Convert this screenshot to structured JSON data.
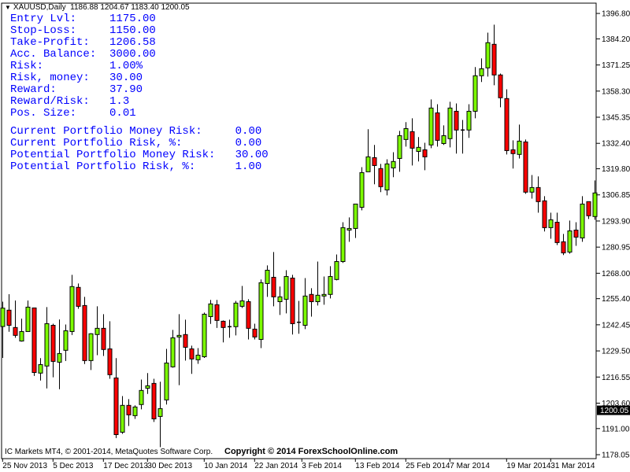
{
  "header": {
    "symbol": "XAUUSD,Daily",
    "ohlc": "1186.88 1204.67 1183.40 1200.05"
  },
  "panel": {
    "rows": [
      {
        "label": "Entry Lvl:",
        "value": "1175.00"
      },
      {
        "label": "Stop-Loss:",
        "value": "1150.00"
      },
      {
        "label": "Take-Profit:",
        "value": "1206.58"
      },
      {
        "label": "Acc. Balance:",
        "value": "3000.00"
      },
      {
        "label": "Risk:",
        "value": "1.00%"
      },
      {
        "label": "Risk, money:",
        "value": "30.00"
      },
      {
        "label": "Reward:",
        "value": "37.90"
      },
      {
        "label": "Reward/Risk:",
        "value": "1.3"
      },
      {
        "label": "Pos. Size:",
        "value": "0.01"
      }
    ],
    "portfolio": [
      {
        "label": "Current Portfolio Money Risk:",
        "value": "0.00"
      },
      {
        "label": "Current Portfolio Risk, %:",
        "value": "0.00"
      },
      {
        "label": "Potential Portfolio Money Risk:",
        "value": "30.00"
      },
      {
        "label": "Potential Portfolio Risk, %:",
        "value": "1.00"
      }
    ],
    "text_color": "#0000ff"
  },
  "footer": {
    "broker": "IC Markets MT4, © 2001-2014, MetaQuotes Software Corp.",
    "copyright": "Copyright © 2014 ForexSchoolOnline.com"
  },
  "chart_data": {
    "type": "candlestick",
    "ylim": [
      1176.1,
      1401.9
    ],
    "grid": false,
    "up_color": "#7cfc00",
    "down_color": "#ff0000",
    "current_price": "1200.05",
    "y_ticks": [
      "1396.80",
      "1384.20",
      "1371.25",
      "1358.30",
      "1345.35",
      "1332.40",
      "1319.80",
      "1306.85",
      "1293.90",
      "1280.95",
      "1268.00",
      "1255.40",
      "1242.45",
      "1229.50",
      "1216.55",
      "1203.60",
      "1191.00",
      "1178.05"
    ],
    "x_ticks": [
      {
        "label": "25 Nov 2013",
        "bar": 0
      },
      {
        "label": "5 Dec 2013",
        "bar": 8
      },
      {
        "label": "17 Dec 2013",
        "bar": 16
      },
      {
        "label": "30 Dec 2013",
        "bar": 23
      },
      {
        "label": "10 Jan 2014",
        "bar": 32
      },
      {
        "label": "22 Jan 2014",
        "bar": 40
      },
      {
        "label": "3 Feb 2014",
        "bar": 47.5
      },
      {
        "label": "13 Feb 2014",
        "bar": 56
      },
      {
        "label": "25 Feb 2014",
        "bar": 64
      },
      {
        "label": "7 Mar 2014",
        "bar": 71
      },
      {
        "label": "19 Mar 2014",
        "bar": 80
      },
      {
        "label": "31 Mar 2014",
        "bar": 87
      }
    ],
    "ohlc": [
      [
        1241.6,
        1253.9,
        1226.0,
        1250.7
      ],
      [
        1249.7,
        1257.6,
        1239.0,
        1242.2
      ],
      [
        1241.1,
        1254.5,
        1236.0,
        1237.2
      ],
      [
        1234.4,
        1245.5,
        1234.1,
        1239.1
      ],
      [
        1239.1,
        1254.5,
        1239.1,
        1251.2
      ],
      [
        1250.8,
        1250.8,
        1217.1,
        1218.8
      ],
      [
        1218.5,
        1225.9,
        1214.8,
        1222.7
      ],
      [
        1222.0,
        1251.2,
        1210.9,
        1243.0
      ],
      [
        1242.2,
        1243.0,
        1216.4,
        1224.3
      ],
      [
        1223.9,
        1245.1,
        1210.5,
        1228.2
      ],
      [
        1229.8,
        1242.6,
        1224.5,
        1239.5
      ],
      [
        1239.1,
        1267.2,
        1237.4,
        1261.4
      ],
      [
        1261.0,
        1262.9,
        1250.4,
        1251.6
      ],
      [
        1252.0,
        1256.3,
        1223.0,
        1224.7
      ],
      [
        1224.7,
        1238.3,
        1220.0,
        1238.0
      ],
      [
        1237.6,
        1251.6,
        1227.4,
        1240.7
      ],
      [
        1240.7,
        1247.7,
        1227.0,
        1230.2
      ],
      [
        1230.5,
        1244.2,
        1215.7,
        1217.7
      ],
      [
        1216.1,
        1225.9,
        1186.3,
        1188.0
      ],
      [
        1189.2,
        1207.1,
        1188.4,
        1202.5
      ],
      [
        1202.5,
        1205.6,
        1192.3,
        1197.8
      ],
      [
        1197.4,
        1202.5,
        1195.8,
        1201.7
      ],
      [
        1202.9,
        1215.3,
        1200.5,
        1209.9
      ],
      [
        1211.0,
        1218.5,
        1208.2,
        1212.2
      ],
      [
        1213.4,
        1215.7,
        1194.3,
        1195.8
      ],
      [
        1197.0,
        1214.2,
        1181.8,
        1200.9
      ],
      [
        1205.2,
        1230.5,
        1202.9,
        1223.5
      ],
      [
        1221.6,
        1239.9,
        1221.2,
        1236.0
      ],
      [
        1236.4,
        1247.7,
        1212.5,
        1237.2
      ],
      [
        1237.6,
        1245.0,
        1224.7,
        1231.3
      ],
      [
        1230.5,
        1232.1,
        1218.1,
        1225.5
      ],
      [
        1225.1,
        1230.9,
        1223.1,
        1227.4
      ],
      [
        1226.6,
        1248.5,
        1226.0,
        1247.7
      ],
      [
        1246.5,
        1254.8,
        1242.9,
        1252.8
      ],
      [
        1252.4,
        1254.8,
        1240.9,
        1244.6
      ],
      [
        1244.2,
        1244.6,
        1233.7,
        1241.1
      ],
      [
        1241.5,
        1245.0,
        1236.0,
        1241.5
      ],
      [
        1241.5,
        1254.3,
        1237.2,
        1253.2
      ],
      [
        1251.6,
        1261.7,
        1250.8,
        1254.3
      ],
      [
        1253.9,
        1255.1,
        1235.2,
        1240.7
      ],
      [
        1240.3,
        1243.0,
        1235.2,
        1236.4
      ],
      [
        1235.2,
        1264.9,
        1230.9,
        1263.3
      ],
      [
        1262.9,
        1271.9,
        1256.3,
        1269.5
      ],
      [
        1266.0,
        1278.5,
        1251.6,
        1256.3
      ],
      [
        1253.9,
        1261.4,
        1247.3,
        1256.3
      ],
      [
        1255.1,
        1269.5,
        1248.1,
        1266.4
      ],
      [
        1265.6,
        1267.2,
        1237.6,
        1243.0
      ],
      [
        1243.6,
        1254.3,
        1238.0,
        1243.7
      ],
      [
        1242.2,
        1265.6,
        1240.3,
        1256.7
      ],
      [
        1257.5,
        1260.6,
        1246.5,
        1253.9
      ],
      [
        1253.9,
        1273.8,
        1252.0,
        1257.1
      ],
      [
        1256.7,
        1266.4,
        1252.4,
        1257.5
      ],
      [
        1257.5,
        1271.5,
        1255.5,
        1266.4
      ],
      [
        1264.9,
        1277.3,
        1264.5,
        1273.8
      ],
      [
        1273.8,
        1293.3,
        1273.1,
        1290.6
      ],
      [
        1289.4,
        1295.7,
        1283.6,
        1290.2
      ],
      [
        1290.2,
        1302.3,
        1285.5,
        1302.3
      ],
      [
        1300.7,
        1320.6,
        1299.2,
        1317.9
      ],
      [
        1318.3,
        1339.4,
        1318.3,
        1325.7
      ],
      [
        1325.3,
        1331.6,
        1312.1,
        1321.4
      ],
      [
        1319.9,
        1322.2,
        1308.2,
        1310.9
      ],
      [
        1309.3,
        1324.5,
        1306.6,
        1322.2
      ],
      [
        1320.2,
        1328.0,
        1315.6,
        1323.4
      ],
      [
        1324.9,
        1338.6,
        1318.3,
        1336.2
      ],
      [
        1334.3,
        1342.9,
        1330.8,
        1339.7
      ],
      [
        1338.2,
        1344.8,
        1321.4,
        1330.0
      ],
      [
        1328.4,
        1335.5,
        1323.4,
        1330.4
      ],
      [
        1329.2,
        1332.7,
        1319.1,
        1325.7
      ],
      [
        1331.6,
        1354.2,
        1330.0,
        1349.9
      ],
      [
        1347.5,
        1351.8,
        1330.8,
        1333.9
      ],
      [
        1332.3,
        1341.3,
        1331.6,
        1336.2
      ],
      [
        1334.7,
        1353.0,
        1330.4,
        1349.9
      ],
      [
        1348.3,
        1352.2,
        1327.3,
        1339.0
      ],
      [
        1339.0,
        1344.0,
        1327.3,
        1339.0
      ],
      [
        1339.0,
        1351.8,
        1335.1,
        1348.3
      ],
      [
        1348.3,
        1370.2,
        1344.8,
        1365.9
      ],
      [
        1365.9,
        1374.5,
        1362.8,
        1369.4
      ],
      [
        1369.8,
        1387.3,
        1365.5,
        1382.3
      ],
      [
        1381.5,
        1391.2,
        1361.2,
        1366.3
      ],
      [
        1366.3,
        1367.0,
        1350.3,
        1355.0
      ],
      [
        1354.6,
        1359.2,
        1326.9,
        1328.8
      ],
      [
        1329.2,
        1333.9,
        1319.9,
        1327.3
      ],
      [
        1326.9,
        1341.7,
        1324.9,
        1333.5
      ],
      [
        1333.1,
        1334.3,
        1307.4,
        1308.2
      ],
      [
        1308.2,
        1316.7,
        1305.0,
        1310.5
      ],
      [
        1310.5,
        1316.0,
        1298.0,
        1303.5
      ],
      [
        1303.9,
        1306.2,
        1288.7,
        1290.6
      ],
      [
        1290.6,
        1298.0,
        1285.1,
        1294.5
      ],
      [
        1293.3,
        1298.0,
        1282.0,
        1283.2
      ],
      [
        1283.6,
        1287.5,
        1277.0,
        1278.1
      ],
      [
        1278.5,
        1294.1,
        1277.7,
        1289.0
      ],
      [
        1289.4,
        1293.3,
        1281.6,
        1285.9
      ],
      [
        1285.5,
        1306.2,
        1283.6,
        1302.3
      ],
      [
        1303.5,
        1303.5,
        1294.9,
        1296.5
      ],
      [
        1296.1,
        1314.0,
        1294.5,
        1307.8
      ]
    ]
  }
}
